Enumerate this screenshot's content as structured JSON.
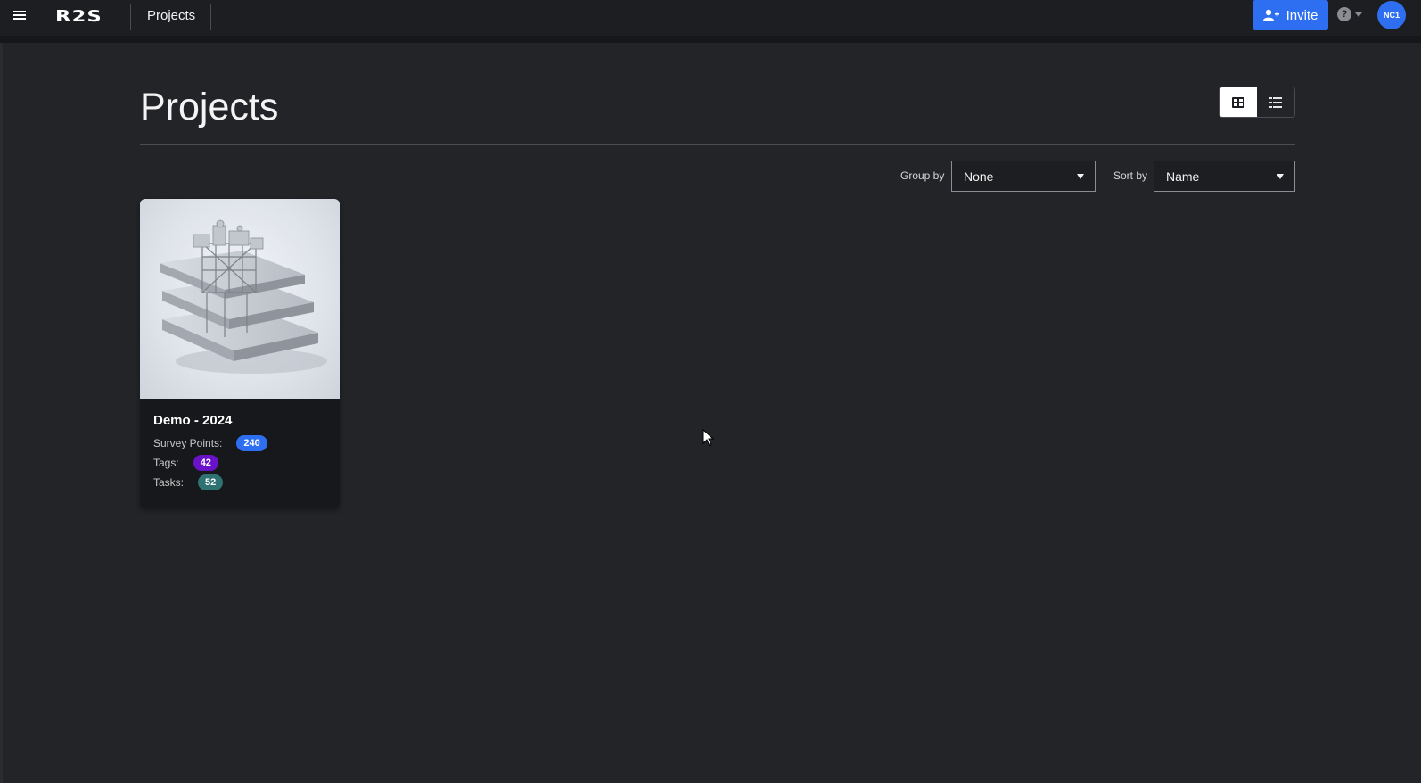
{
  "topbar": {
    "logo": "R2S",
    "breadcrumb": "Projects",
    "invite_label": "Invite",
    "help_symbol": "?",
    "avatar_initials": "NC1",
    "accent_color": "#2e6ff2"
  },
  "main": {
    "title": "Projects",
    "view_toggle": {
      "active": "grid",
      "options": [
        "grid",
        "list"
      ]
    },
    "group_by": {
      "label": "Group by",
      "value": "None"
    },
    "sort_by": {
      "label": "Sort by",
      "value": "Name"
    }
  },
  "projects": [
    {
      "name": "Demo - 2024",
      "stats": [
        {
          "label": "Survey Points:",
          "value": "240",
          "color": "#2e6ff2"
        },
        {
          "label": "Tags:",
          "value": "42",
          "color": "#6a12c7"
        },
        {
          "label": "Tasks:",
          "value": "52",
          "color": "#2f7272"
        }
      ]
    }
  ]
}
